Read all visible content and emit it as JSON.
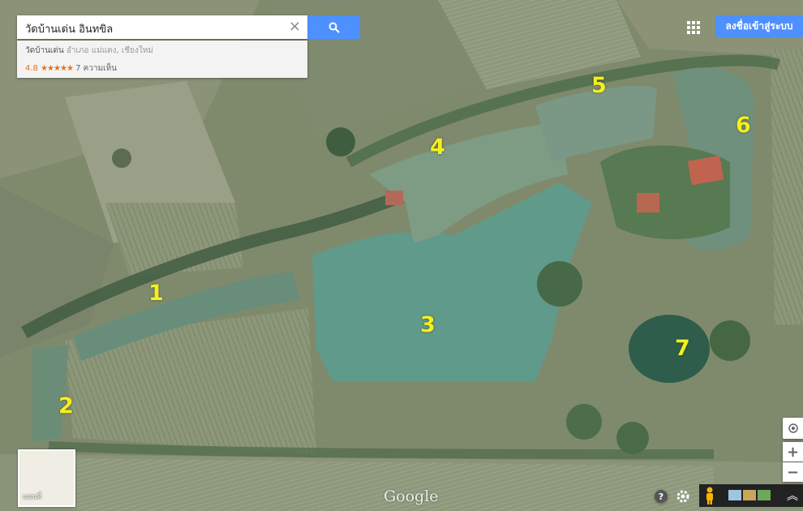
{
  "search": {
    "value": "วัดบ้านเด่น อินทขิล",
    "clear_symbol": "×"
  },
  "suggestion": {
    "name": "วัดบ้านเด่น",
    "address": "อำเภอ แม่แตง, เชียงใหม่",
    "rating": "4.8",
    "stars": "★★★★★",
    "reviews": "7 ความเห็น"
  },
  "header": {
    "signin_label": "ลงชื่อเข้าสู่ระบบ"
  },
  "markers": [
    "1",
    "2",
    "3",
    "4",
    "5",
    "6",
    "7"
  ],
  "minimap": {
    "label": "แผนที่"
  },
  "logo": "Google",
  "controls": {
    "zoom_in": "+",
    "zoom_out": "−",
    "help": "?",
    "expand": "︽"
  },
  "colors": {
    "accent": "#4d90fe",
    "marker": "#f4ef1e",
    "water": "#5f9a8a",
    "field": "#8a9373",
    "trees": "#3c5a3c"
  }
}
